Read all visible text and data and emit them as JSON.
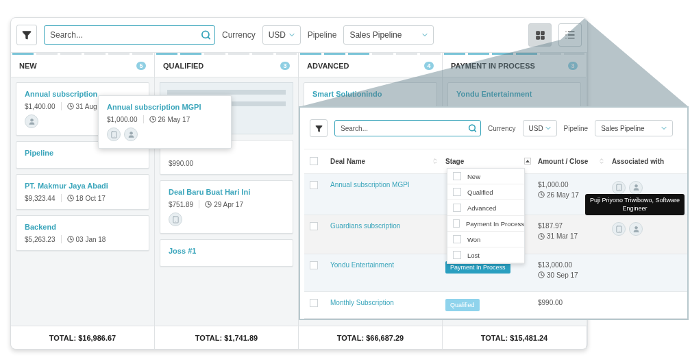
{
  "board": {
    "toolbar": {
      "search": {
        "placeholder": "Search..."
      },
      "currency": {
        "label": "Currency",
        "value": "USD"
      },
      "pipeline": {
        "label": "Pipeline",
        "value": "Sales Pipeline"
      },
      "views": [
        {
          "kind": "grid",
          "selected": true
        },
        {
          "kind": "list",
          "selected": false
        }
      ]
    },
    "columns": [
      {
        "title": "NEW",
        "count": "5",
        "level": 0.17,
        "cards": [
          {
            "kind": "deal",
            "title": "Annual subscription",
            "amount": "$1,400.00",
            "date": "31 Aug",
            "associates": [
              {
                "kind": "person"
              }
            ]
          },
          {
            "kind": "deal",
            "title": "Pipeline"
          },
          {
            "kind": "deal",
            "title": "PT. Makmur Jaya Abadi",
            "amount": "$9,323.44",
            "date": "18 Oct 17"
          },
          {
            "kind": "deal",
            "title": "Backend",
            "amount": "$5,263.23",
            "date": "03 Jan 18"
          }
        ],
        "total": "TOTAL: $16,986.67"
      },
      {
        "title": "QUALIFIED",
        "count": "3",
        "level": 0.33,
        "cards": [
          {
            "kind": "placeholder"
          },
          {
            "kind": "deal",
            "amount": "$990.00"
          },
          {
            "kind": "deal",
            "title": "Deal Baru Buat Hari Ini",
            "amount": "$751.89",
            "date": "29 Apr 17",
            "associates": [
              {
                "kind": "company"
              }
            ]
          },
          {
            "kind": "deal",
            "title": "Joss #1"
          }
        ],
        "total": "TOTAL: $1,741.89"
      },
      {
        "title": "ADVANCED",
        "count": "4",
        "level": 0.5,
        "cards": [
          {
            "kind": "deal",
            "title": "Smart Solutionindo"
          }
        ],
        "total": "TOTAL: $66,687.29"
      },
      {
        "title": "PAYMENT IN PROCESS",
        "count": "3",
        "level": 0.67,
        "cards": [
          {
            "kind": "deal",
            "title": "Yondu Entertainment"
          }
        ],
        "total": "TOTAL: $15,481.24"
      }
    ],
    "dragged_card": {
      "title": "Annual subscription MGPI",
      "amount": "$1,000.00",
      "date": "26 May 17",
      "associates": [
        {
          "kind": "company"
        },
        {
          "kind": "person"
        }
      ]
    }
  },
  "zoom_panel": {
    "toolbar": {
      "search": {
        "placeholder": "Search..."
      },
      "currency": {
        "label": "Currency",
        "value": "USD"
      },
      "pipeline": {
        "label": "Pipeline",
        "value": "Sales Pipeline"
      }
    },
    "table": {
      "select_all": {
        "checked": false
      },
      "columns": [
        {
          "label": "Deal Name",
          "kind": "sort"
        },
        {
          "label": "Stage",
          "kind": "filter"
        },
        {
          "label": "Amount / Close",
          "kind": "sort"
        },
        {
          "label": "Associated with",
          "kind": "plain"
        }
      ],
      "rows": [
        {
          "name": "Annual subscription MGPI",
          "checked": false,
          "kind": "striped",
          "amount": "$1,000.00",
          "date": "26 May 17",
          "associates": [
            {
              "kind": "company"
            },
            {
              "kind": "person"
            }
          ]
        },
        {
          "name": "Guardians subscription",
          "checked": false,
          "kind": "hovered",
          "amount": "$187.97",
          "date": "31 Mar 17",
          "associates": [
            {
              "kind": "company"
            },
            {
              "kind": "person"
            }
          ]
        },
        {
          "name": "Yondu Entertainment",
          "checked": false,
          "kind": "striped",
          "stage": {
            "label": "Payment In Process",
            "kind": "active"
          },
          "amount": "$13,000.00",
          "date": "30 Sep 17"
        },
        {
          "name": "Monthly Subscription",
          "checked": false,
          "kind": "plain",
          "stage": {
            "label": "Qualified",
            "kind": "muted"
          },
          "amount": "$990.00"
        }
      ]
    },
    "stage_filter": {
      "options": [
        {
          "label": "New",
          "checked": false
        },
        {
          "label": "Qualified",
          "checked": false
        },
        {
          "label": "Advanced",
          "checked": false
        },
        {
          "label": "Payment In Process",
          "checked": false
        },
        {
          "label": "Won",
          "checked": false
        },
        {
          "label": "Lost",
          "checked": false
        }
      ]
    },
    "tooltip": "Puji Priyono Triwibowo, Software Engineer"
  }
}
